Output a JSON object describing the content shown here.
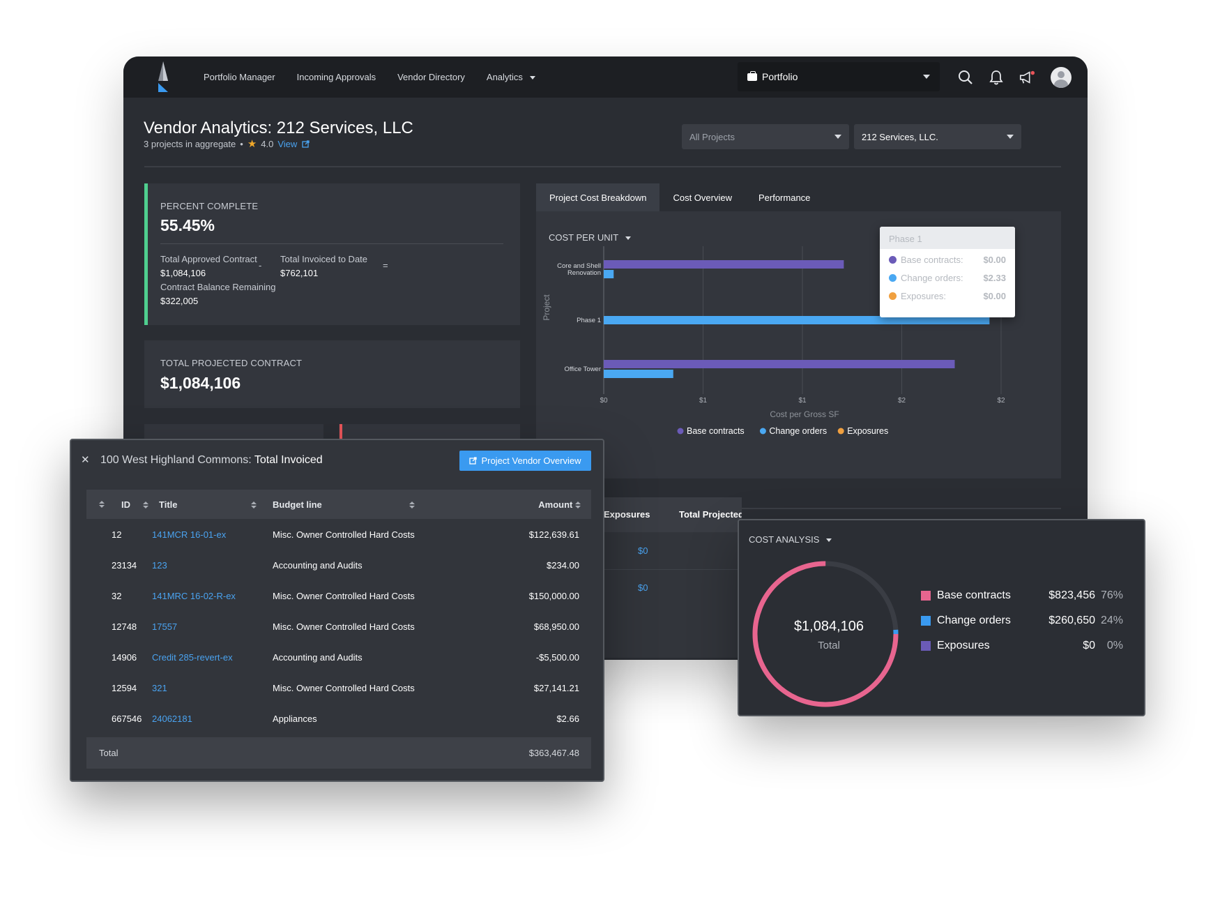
{
  "nav": {
    "items": [
      "Portfolio Manager",
      "Incoming Approvals",
      "Vendor Directory",
      "Analytics"
    ],
    "portfolio_select": "Portfolio"
  },
  "header": {
    "title": "Vendor Analytics: 212 Services, LLC",
    "subtitle": "3 projects in aggregate",
    "rating": "4.0",
    "view_link": "View",
    "projects_filter": "All Projects",
    "vendor_filter": "212 Services, LLC."
  },
  "kpi": {
    "percent_complete": {
      "label": "PERCENT COMPLETE",
      "value": "55.45%",
      "approved_label": "Total Approved Contract",
      "approved_value": "$1,084,106",
      "minus": "-",
      "invoiced_label": "Total Invoiced to Date",
      "invoiced_value": "$762,101",
      "equals": "=",
      "balance_label": "Contract Balance Remaining",
      "balance_value": "$322,005"
    },
    "projected": {
      "label": "TOTAL PROJECTED CONTRACT",
      "value": "$1,084,106"
    }
  },
  "tabs": [
    "Project Cost Breakdown",
    "Cost Overview",
    "Performance"
  ],
  "cost_chart": {
    "selector": "COST PER UNIT",
    "tooltip": {
      "title": "Phase 1",
      "rows": [
        {
          "label": "Base contracts:",
          "value": "$0.00",
          "color": "#6b5bb8"
        },
        {
          "label": "Change orders:",
          "value": "$2.33",
          "color": "#4aa8f2"
        },
        {
          "label": "Exposures:",
          "value": "$0.00",
          "color": "#f0a040"
        }
      ]
    }
  },
  "chart_data": {
    "type": "bar",
    "orientation": "horizontal",
    "categories": [
      "Core and Shell Renovation",
      "Phase 1",
      "Office Tower"
    ],
    "series": [
      {
        "name": "Base contracts",
        "color": "#6b5bb8",
        "values": [
          1.45,
          0,
          2.12
        ]
      },
      {
        "name": "Change orders",
        "color": "#4aa8f2",
        "values": [
          0.06,
          2.33,
          0.42
        ]
      },
      {
        "name": "Exposures",
        "color": "#f0a040",
        "values": [
          0,
          0,
          0
        ]
      }
    ],
    "xlabel": "Cost per Gross SF",
    "ylabel": "Project",
    "xlim": [
      0,
      2.4
    ],
    "x_ticks": [
      {
        "value": 0,
        "label": "$0"
      },
      {
        "value": 0.6,
        "label": "$1"
      },
      {
        "value": 1.2,
        "label": "$1"
      },
      {
        "value": 1.8,
        "label": "$2"
      },
      {
        "value": 2.4,
        "label": "$2"
      }
    ],
    "grid": true,
    "legend_position": "bottom"
  },
  "behind_table": {
    "headers": [
      "Exposures",
      "Total Projected"
    ],
    "cells": [
      "$0",
      "$0"
    ]
  },
  "invoice_modal": {
    "title_prefix": "100 West Highland Commons:",
    "title_bold": "Total Invoiced",
    "button": "Project Vendor Overview",
    "columns": [
      "ID",
      "Title",
      "Budget line",
      "Amount"
    ],
    "rows": [
      {
        "id": "12",
        "title": "141MCR 16-01-ex",
        "budget": "Misc. Owner Controlled Hard Costs",
        "amount": "$122,639.61"
      },
      {
        "id": "23134",
        "title": "123",
        "budget": "Accounting and Audits",
        "amount": "$234.00"
      },
      {
        "id": "32",
        "title": "141MRC 16-02-R-ex",
        "budget": "Misc. Owner Controlled Hard Costs",
        "amount": "$150,000.00"
      },
      {
        "id": "12748",
        "title": "17557",
        "budget": "Misc. Owner Controlled Hard Costs",
        "amount": "$68,950.00"
      },
      {
        "id": "14906",
        "title": "Credit 285-revert-ex",
        "budget": "Accounting and Audits",
        "amount": "-$5,500.00"
      },
      {
        "id": "12594",
        "title": "321",
        "budget": "Misc. Owner Controlled Hard Costs",
        "amount": "$27,141.21"
      },
      {
        "id": "667546",
        "title": "24062181",
        "budget": "Appliances",
        "amount": "$2.66"
      }
    ],
    "total_label": "Total",
    "total_value": "$363,467.48"
  },
  "cost_analysis": {
    "title": "COST ANALYSIS",
    "total_value": "$1,084,106",
    "total_label": "Total",
    "items": [
      {
        "label": "Base contracts",
        "value": "$823,456",
        "pct": "76%",
        "color": "#e8658f",
        "fraction": 0.76
      },
      {
        "label": "Change orders",
        "value": "$260,650",
        "pct": "24%",
        "color": "#3a9af0",
        "fraction": 0.24
      },
      {
        "label": "Exposures",
        "value": "$0",
        "pct": "0%",
        "color": "#6b5bb8",
        "fraction": 0
      }
    ]
  }
}
